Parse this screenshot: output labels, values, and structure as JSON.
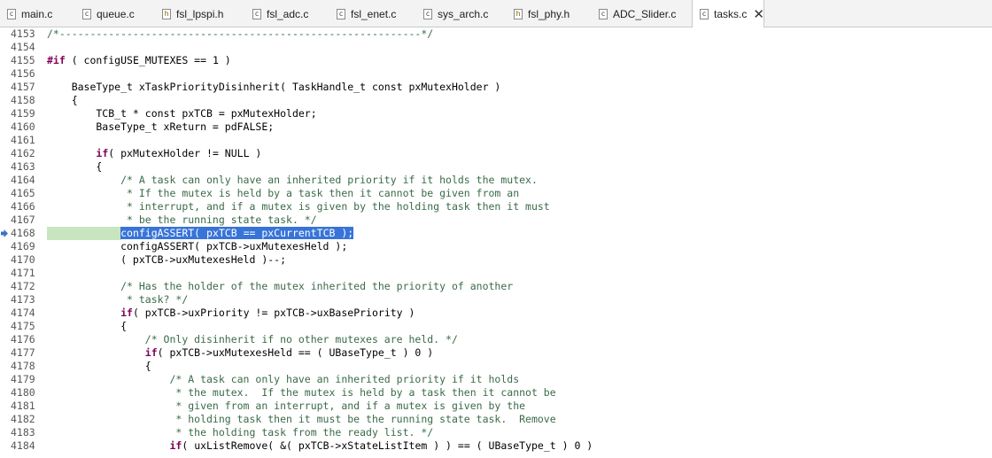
{
  "tabs": [
    {
      "label": "main.c",
      "icon": "c-source-file-icon",
      "type": "c"
    },
    {
      "label": "queue.c",
      "icon": "c-source-file-icon",
      "type": "c"
    },
    {
      "label": "fsl_lpspi.h",
      "icon": "h-header-file-icon",
      "type": "h"
    },
    {
      "label": "fsl_adc.c",
      "icon": "c-source-file-icon",
      "type": "c"
    },
    {
      "label": "fsl_enet.c",
      "icon": "c-source-file-icon",
      "type": "c"
    },
    {
      "label": "sys_arch.c",
      "icon": "c-source-file-icon",
      "type": "c"
    },
    {
      "label": "fsl_phy.h",
      "icon": "h-header-file-icon",
      "type": "h"
    },
    {
      "label": "ADC_Slider.c",
      "icon": "c-source-file-icon",
      "type": "c"
    },
    {
      "label": "tasks.c",
      "icon": "c-source-file-icon",
      "type": "c",
      "active": true
    }
  ],
  "icon_glyphs": {
    "c": "c",
    "h": "h",
    "close": "✕"
  },
  "colors": {
    "comment": "#3a6a48",
    "keyword": "#7f0055",
    "selection": "#3874d8",
    "current_line": "#c7e6c0",
    "debug_arrow": "#3a73c4"
  },
  "editor": {
    "current_line": 4168,
    "selected_text": "configASSERT( pxTCB == pxCurrentTCB );",
    "lines": [
      {
        "num": "4153",
        "text": "/*-----------------------------------------------------------*/"
      },
      {
        "num": "4154",
        "text": ""
      },
      {
        "num": "4155",
        "text": "#if ( configUSE_MUTEXES == 1 )"
      },
      {
        "num": "4156",
        "text": ""
      },
      {
        "num": "4157",
        "text": "    BaseType_t xTaskPriorityDisinherit( TaskHandle_t const pxMutexHolder )"
      },
      {
        "num": "4158",
        "text": "    {"
      },
      {
        "num": "4159",
        "text": "        TCB_t * const pxTCB = pxMutexHolder;"
      },
      {
        "num": "4160",
        "text": "        BaseType_t xReturn = pdFALSE;"
      },
      {
        "num": "4161",
        "text": ""
      },
      {
        "num": "4162",
        "text": "        if( pxMutexHolder != NULL )"
      },
      {
        "num": "4163",
        "text": "        {"
      },
      {
        "num": "4164",
        "text": "            /* A task can only have an inherited priority if it holds the mutex."
      },
      {
        "num": "4165",
        "text": "             * If the mutex is held by a task then it cannot be given from an"
      },
      {
        "num": "4166",
        "text": "             * interrupt, and if a mutex is given by the holding task then it must"
      },
      {
        "num": "4167",
        "text": "             * be the running state task. */"
      },
      {
        "num": "4168",
        "text": "            configASSERT( pxTCB == pxCurrentTCB );"
      },
      {
        "num": "4169",
        "text": "            configASSERT( pxTCB->uxMutexesHeld );"
      },
      {
        "num": "4170",
        "text": "            ( pxTCB->uxMutexesHeld )--;"
      },
      {
        "num": "4171",
        "text": ""
      },
      {
        "num": "4172",
        "text": "            /* Has the holder of the mutex inherited the priority of another"
      },
      {
        "num": "4173",
        "text": "             * task? */"
      },
      {
        "num": "4174",
        "text": "            if( pxTCB->uxPriority != pxTCB->uxBasePriority )"
      },
      {
        "num": "4175",
        "text": "            {"
      },
      {
        "num": "4176",
        "text": "                /* Only disinherit if no other mutexes are held. */"
      },
      {
        "num": "4177",
        "text": "                if( pxTCB->uxMutexesHeld == ( UBaseType_t ) 0 )"
      },
      {
        "num": "4178",
        "text": "                {"
      },
      {
        "num": "4179",
        "text": "                    /* A task can only have an inherited priority if it holds"
      },
      {
        "num": "4180",
        "text": "                     * the mutex.  If the mutex is held by a task then it cannot be"
      },
      {
        "num": "4181",
        "text": "                     * given from an interrupt, and if a mutex is given by the"
      },
      {
        "num": "4182",
        "text": "                     * holding task then it must be the running state task.  Remove"
      },
      {
        "num": "4183",
        "text": "                     * the holding task from the ready list. */"
      },
      {
        "num": "4184",
        "text": "                    if( uxListRemove( &( pxTCB->xStateListItem ) ) == ( UBaseType_t ) 0 )"
      }
    ]
  }
}
